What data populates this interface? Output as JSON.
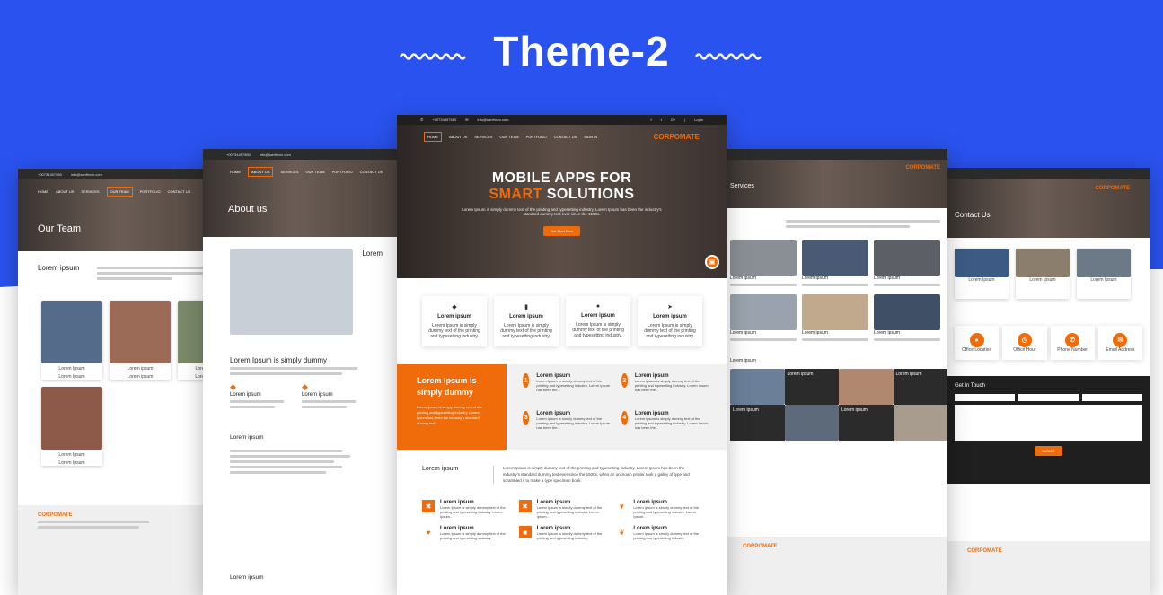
{
  "headline": "Theme-2",
  "colors": {
    "background_blue": "#2a52ee",
    "accent": "#f06c0a",
    "dark": "#2b2b2b"
  },
  "team_page": {
    "topbar": [
      "+00734457580",
      "info@sanfhxxx.com"
    ],
    "nav": [
      "HOME",
      "ABOUT US",
      "SERVICES",
      "OUR TEAM",
      "PORTFOLIO",
      "CONTACT US"
    ],
    "active_nav": "OUR TEAM",
    "title": "Our Team",
    "section_title": "Lorem ipsum",
    "members": [
      {
        "name": "Lorem Ipsum",
        "role": "Lorem Ipsum"
      },
      {
        "name": "Lorem ipsum",
        "role": "Lorem ipsum"
      },
      {
        "name": "Lorem ipsum",
        "role": "Lorem Ipsum"
      },
      {
        "name": "Lorem Ipsum",
        "role": "Lorem Ipsum"
      }
    ],
    "footer_brand": "CORPOMATE"
  },
  "about_page": {
    "topbar": [
      "+00734457580",
      "info@sanfhxxx.com"
    ],
    "nav": [
      "HOME",
      "ABOUT US",
      "SERVICES",
      "OUR TEAM",
      "PORTFOLIO",
      "CONTACT US"
    ],
    "title": "About us",
    "subtitle": "Lorem Ipsum is simply dummy",
    "feature1": "Lorem ipsum",
    "feature2": "Lorem ipsum",
    "section2": "Lorem ipsum",
    "section3": "Lorem ipsum",
    "side_label": "Lorem"
  },
  "main_page": {
    "topbar_phone": "+00734457580",
    "topbar_email": "info@sanfhxxx.com",
    "topbar_login": "Login",
    "social": [
      "f",
      "t",
      "G+",
      "|"
    ],
    "nav": [
      "HOME",
      "ABOUT US",
      "SERVICES",
      "OUR TEAM",
      "PORTFOLIO",
      "CONTACT US",
      "SIGN IN"
    ],
    "brand": "CORPOMATE",
    "hero_line1": "MOBILE APPS FOR",
    "hero_line2_accent": "SMART",
    "hero_line2_rest": "SOLUTIONS",
    "hero_text": "Lorem Ipsum is simply dummy text of the printing and typesetting industry. Lorem Ipsum has been the industry's standard dummy text ever since the 1500s.",
    "hero_button": "Get Start Now",
    "features": [
      {
        "icon": "diamond-icon",
        "glyph": "◆",
        "title": "Lorem ipsum",
        "text": "Lorem Ipsum is simply dummy text of the printing and typesetting industry."
      },
      {
        "icon": "book-icon",
        "glyph": "▮",
        "title": "Lorem ipsum",
        "text": "Lorem Ipsum is simply dummy text of the printing and typesetting industry."
      },
      {
        "icon": "globe-icon",
        "glyph": "●",
        "title": "Lorem ipsum",
        "text": "Lorem Ipsum is simply dummy text of the printing and typesetting industry."
      },
      {
        "icon": "rocket-icon",
        "glyph": "➤",
        "title": "Lorem ipsum",
        "text": "Lorem Ipsum is simply dummy text of the printing and typesetting industry."
      }
    ],
    "orange_title": "Lorem Ipsum is simply dummy",
    "orange_text": "Lorem Ipsum is simply dummy text of the printing and typesetting industry. Lorem Ipsum has been the industry's standard dummy text.",
    "steps": [
      {
        "num": "1",
        "title": "Lorem ipsum",
        "text": "Lorem Ipsum is simply dummy text of the printing and typesetting industry. Lorem Ipsum has been the..."
      },
      {
        "num": "2",
        "title": "Lorem ipsum",
        "text": "Lorem Ipsum is simply dummy text of the printing and typesetting industry. Lorem Ipsum has been the..."
      },
      {
        "num": "3",
        "title": "Lorem ipsum",
        "text": "Lorem Ipsum is simply dummy text of the printing and typesetting industry. Lorem Ipsum has been the..."
      },
      {
        "num": "4",
        "title": "Lorem ipsum",
        "text": "Lorem Ipsum is simply dummy text of the printing and typesetting industry. Lorem Ipsum has been the..."
      }
    ],
    "intro_title": "Lorem ipsum",
    "intro_text": "Lorem Ipsum is simply dummy text of the printing and typesetting industry. Lorem Ipsum has been the industry's standard dummy text ever since the 1500s, when an unknown printer took a galley of type and scrambled it to make a type specimen book.",
    "services": [
      {
        "icon": "close-icon",
        "glyph": "✖",
        "title": "Lorem ipsum",
        "text": "Lorem Ipsum is simply dummy text of the printing and typesetting industry. Lorem Ipsum..."
      },
      {
        "icon": "close-icon",
        "glyph": "✖",
        "title": "Lorem ipsum",
        "text": "Lorem Ipsum is simply dummy text of the printing and typesetting industry. Lorem Ipsum..."
      },
      {
        "icon": "cocktail-icon",
        "glyph": "▼",
        "title": "Lorem ipsum",
        "text": "Lorem Ipsum is simply dummy text of the printing and typesetting industry. Lorem Ipsum..."
      },
      {
        "icon": "heart-icon",
        "glyph": "♥",
        "title": "Lorem ipsum",
        "text": "Lorem Ipsum is simply dummy text of the printing and typesetting industry."
      },
      {
        "icon": "badge-icon",
        "glyph": "■",
        "title": "Lorem ipsum",
        "text": "Lorem Ipsum is simply dummy text of the printing and typesetting industry."
      },
      {
        "icon": "leaf-icon",
        "glyph": "❦",
        "title": "Lorem ipsum",
        "text": "Lorem Ipsum is simply dummy text of the printing and typesetting industry."
      }
    ]
  },
  "services_page": {
    "title": "Services",
    "brand": "CORPOMATE",
    "items": [
      "Lorem ipsum",
      "Lorem ipsum",
      "Lorem ipsum",
      "Lorem ipsum",
      "Lorem ipsum",
      "Lorem ipsum"
    ],
    "section": "Lorem ipsum",
    "gallery": [
      "Lorem ipsum",
      "Lorem ipsum",
      "Lorem ipsum",
      "Lorem ipsum"
    ],
    "footer_brand": "CORPOMATE"
  },
  "contact_page": {
    "title": "Contact Us",
    "brand": "CORPOMATE",
    "offices": [
      "Lorem Ipsum",
      "Lorem Ipsum",
      "Lorem Ipsum"
    ],
    "contact_items": [
      "Office Location",
      "Office Hour",
      "Phone Number",
      "Email Address"
    ],
    "form_title": "Get In Touch",
    "send_label": "SUBMIT",
    "footer_brand": "CORPOMATE"
  }
}
